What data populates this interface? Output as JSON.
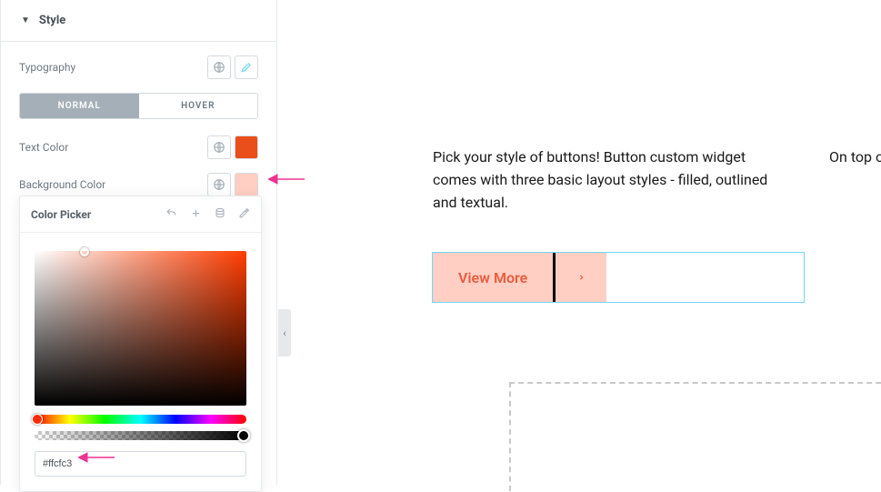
{
  "section": {
    "title": "Style"
  },
  "fields": {
    "typography_label": "Typography",
    "text_color_label": "Text Color",
    "background_color_label": "Background Color",
    "text_color_swatch": "#ea4e1b",
    "background_color_swatch": "#ffcfc3"
  },
  "tabs": {
    "normal": "NORMAL",
    "hover": "HOVER"
  },
  "picker": {
    "title": "Color Picker",
    "hex": "#ffcfc3"
  },
  "preview": {
    "paragraph_left": "Pick your style of buttons! Button custom widget comes with three basic layout styles - filled, outlined and textual.",
    "paragraph_right": "On top of that you will also get another standard",
    "button_label": "View More"
  }
}
